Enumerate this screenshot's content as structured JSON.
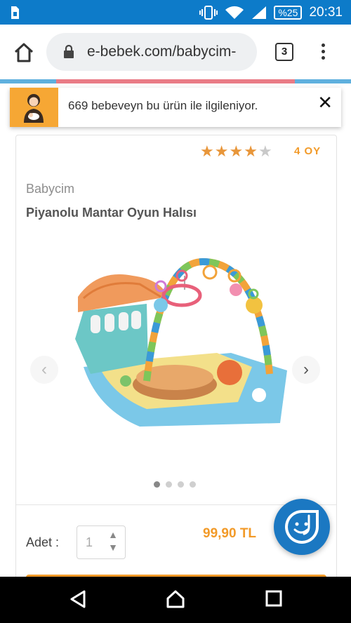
{
  "status_bar": {
    "battery": "%25",
    "time": "20:31"
  },
  "browser": {
    "url": "e-bebek.com/babycim-",
    "tab_count": "3"
  },
  "notice": {
    "text": "669 bebeveyn bu ürün ile ilgileniyor.",
    "close_label": "✕"
  },
  "product": {
    "rating": 4,
    "rating_max": 5,
    "review_count": "4 OY",
    "brand": "Babycim",
    "title": "Piyanolu Mantar Oyun Halısı",
    "gallery": {
      "image_count": 4,
      "active_index": 0
    }
  },
  "purchase": {
    "qty_label": "Adet :",
    "qty_value": "1",
    "price": "99,90 TL"
  },
  "colors": {
    "status_bar": "#0d7bc9",
    "accent_orange": "#f29a28",
    "chat_blue": "#1b78c2"
  },
  "icons": [
    "sim-icon",
    "vibrate-icon",
    "wifi-icon",
    "signal-icon",
    "battery-icon",
    "home-icon",
    "lock-icon",
    "tabs-icon",
    "menu-icon",
    "mother-baby-icon",
    "close-icon",
    "star-icon",
    "chevron-left-icon",
    "chevron-right-icon",
    "chat-icon",
    "back-icon",
    "home-nav-icon",
    "recents-icon"
  ]
}
